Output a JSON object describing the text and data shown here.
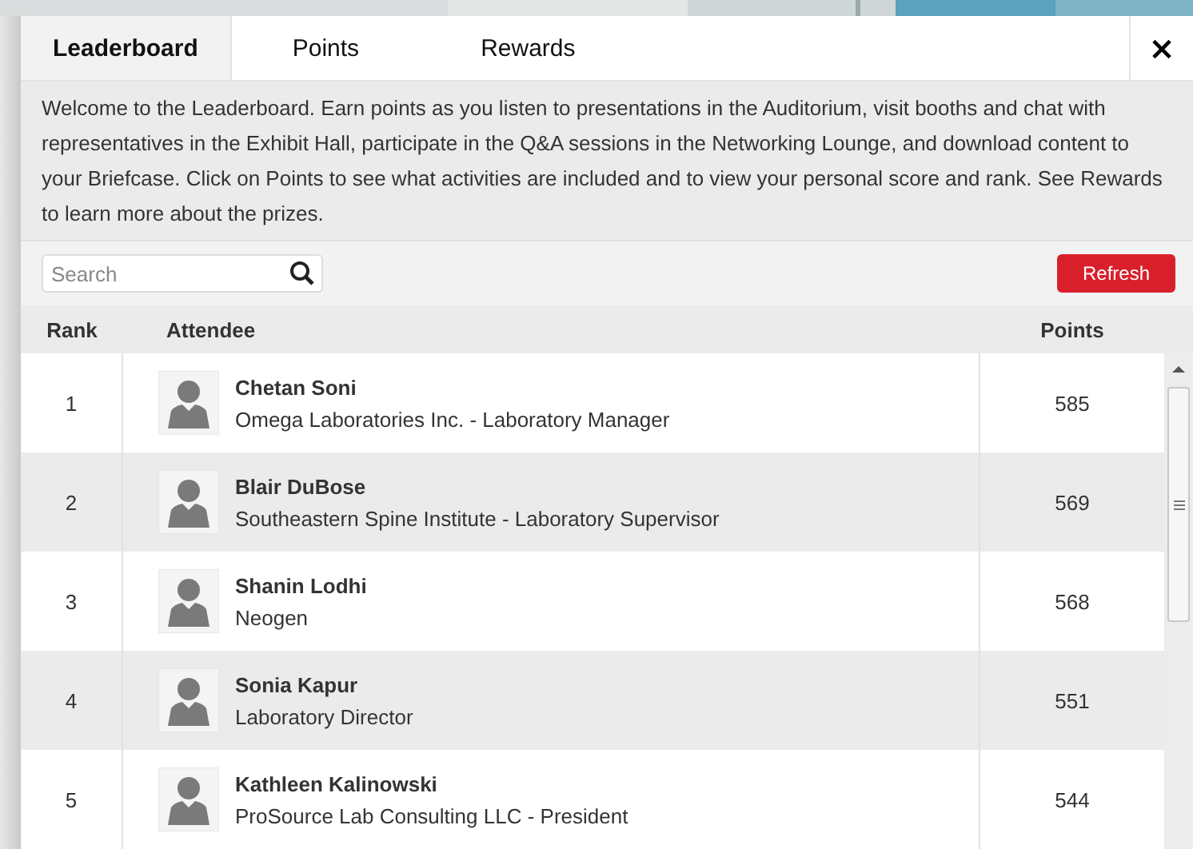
{
  "tabs": [
    {
      "label": "Leaderboard",
      "selected": true
    },
    {
      "label": "Points",
      "selected": false
    },
    {
      "label": "Rewards",
      "selected": false
    }
  ],
  "close": "×",
  "intro": "Welcome to the Leaderboard. Earn points as you listen to presentations in the Auditorium, visit booths and chat with representatives in the Exhibit Hall, participate in the Q&A sessions in the Networking Lounge, and download content to your Briefcase. Click on Points to see what activities are included and to view your personal score and rank. See Rewards to learn more about the prizes.",
  "search": {
    "placeholder": "Search"
  },
  "refresh": "Refresh",
  "table": {
    "columns": [
      "Rank",
      "Attendee",
      "Points"
    ],
    "rows": [
      {
        "rank": "1",
        "name": "Chetan Soni",
        "detail": "Omega Laboratories Inc. - Laboratory Manager",
        "points": "585"
      },
      {
        "rank": "2",
        "name": "Blair DuBose",
        "detail": "Southeastern Spine Institute - Laboratory Supervisor",
        "points": "569"
      },
      {
        "rank": "3",
        "name": "Shanin Lodhi",
        "detail": "Neogen",
        "points": "568"
      },
      {
        "rank": "4",
        "name": "Sonia Kapur",
        "detail": "Laboratory Director",
        "points": "551"
      },
      {
        "rank": "5",
        "name": "Kathleen Kalinowski",
        "detail": "ProSource Lab Consulting LLC - President",
        "points": "544"
      }
    ]
  }
}
